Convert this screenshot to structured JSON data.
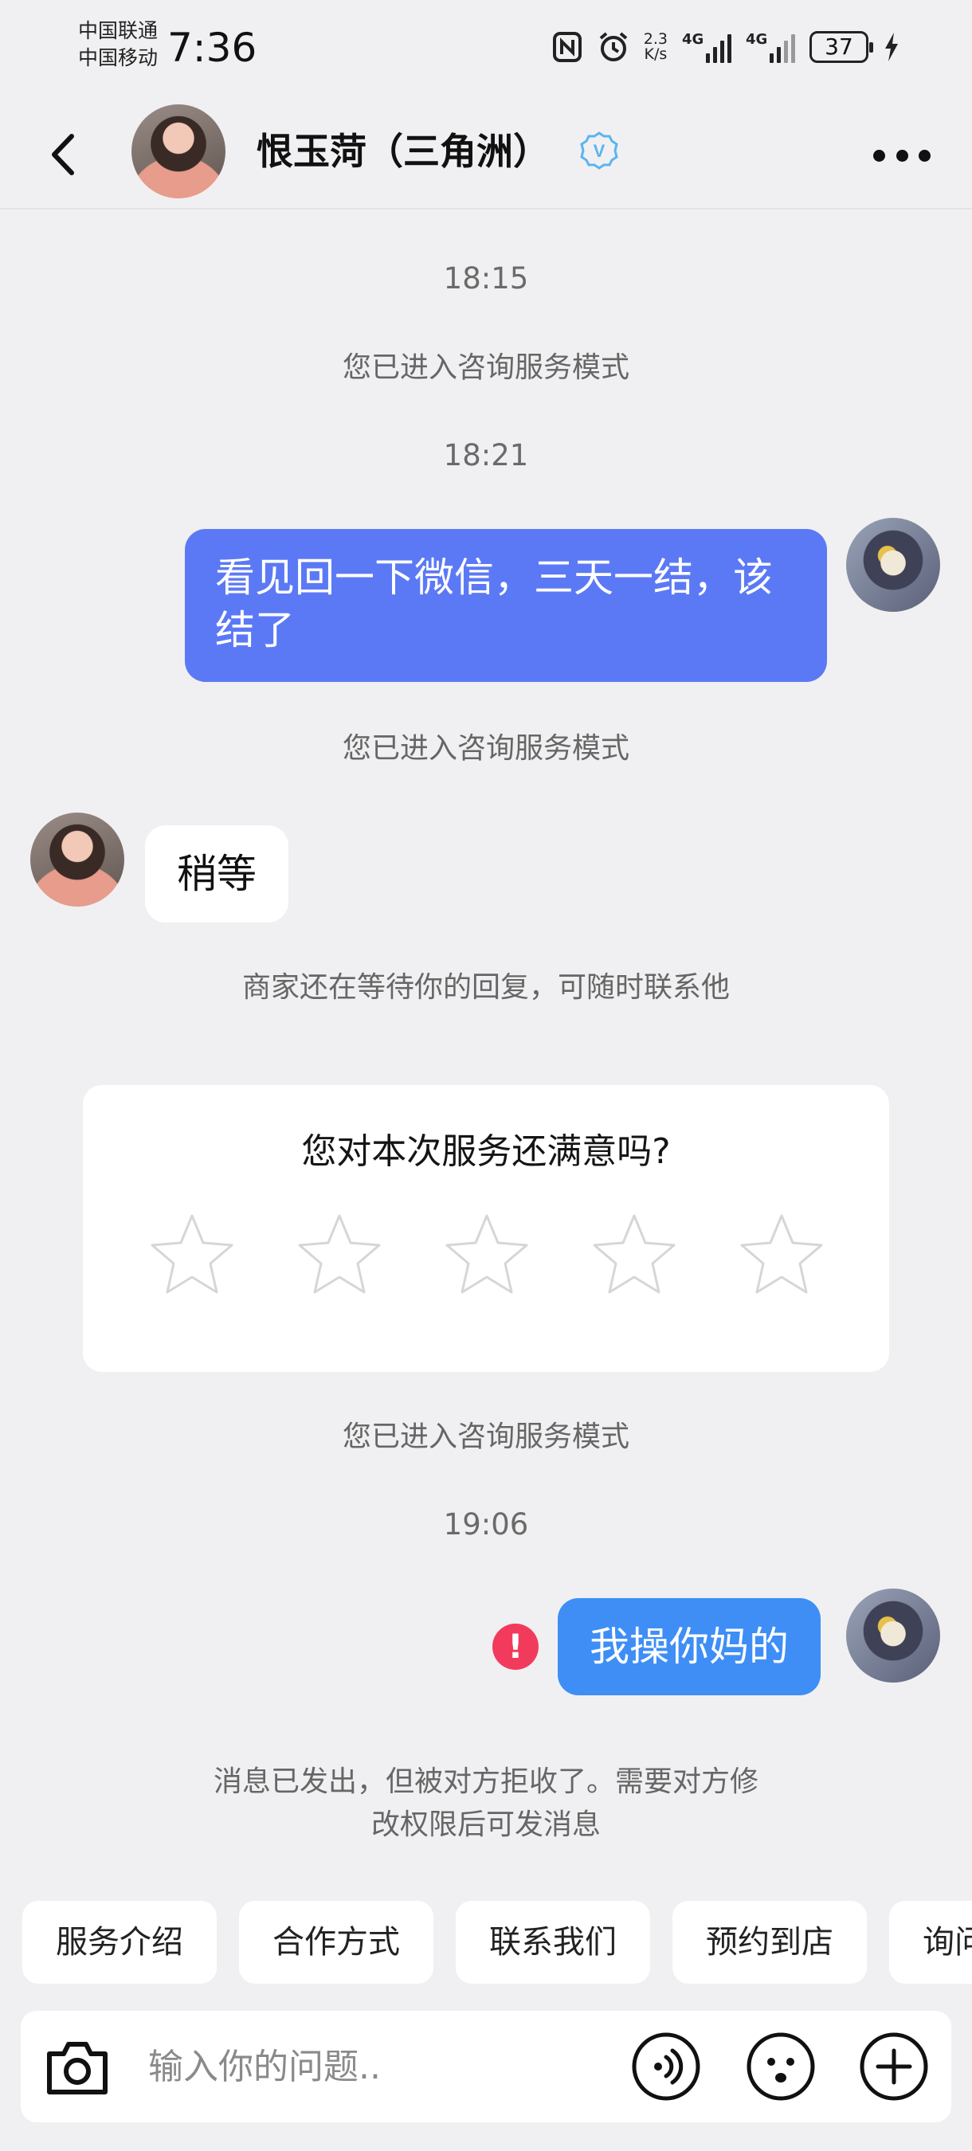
{
  "status_bar": {
    "carrier_1": "中国联通",
    "carrier_2": "中国移动",
    "time": "7:36",
    "net_speed_value": "2.3",
    "net_speed_unit": "K/s",
    "signal_1_label": "4G",
    "signal_2_label": "4G",
    "battery": "37"
  },
  "header": {
    "title": "恨玉菏（三角洲）",
    "verify_badge": "V"
  },
  "messages": {
    "time_1": "18:15",
    "system_1": "您已进入咨询服务模式",
    "time_2": "18:21",
    "outgoing_1": "看见回一下微信，三天一结，该结了",
    "system_2": "您已进入咨询服务模式",
    "incoming_1": "稍等",
    "system_3": "商家还在等待你的回复，可随时联系他",
    "system_4": "您已进入咨询服务模式",
    "time_3": "19:06",
    "outgoing_2": "我操你妈的",
    "error_mark": "!",
    "rejected_line_1": "消息已发出，但被对方拒收了。需要对方修",
    "rejected_line_2": "改权限后可发消息"
  },
  "rating": {
    "question": "您对本次服务还满意吗?",
    "stars_total": 5,
    "stars_selected": 0
  },
  "quick_actions": [
    "服务介绍",
    "合作方式",
    "联系我们",
    "预约到店",
    "询问"
  ],
  "input": {
    "placeholder": "输入你的问题.."
  },
  "colors": {
    "background": "#f0f0f2",
    "outgoing_bubble_1": "#5c79f5",
    "outgoing_bubble_2": "#3e8ef6",
    "error": "#f23b5c",
    "verify_badge": "#5ab4f0"
  },
  "icons": {
    "back": "chevron-left-icon",
    "more": "more-dots-icon",
    "verify": "verified-badge-icon",
    "camera": "camera-icon",
    "voice": "voice-icon",
    "emoji": "emoji-icon",
    "add": "plus-icon",
    "star": "star-outline-icon",
    "error": "error-icon"
  }
}
